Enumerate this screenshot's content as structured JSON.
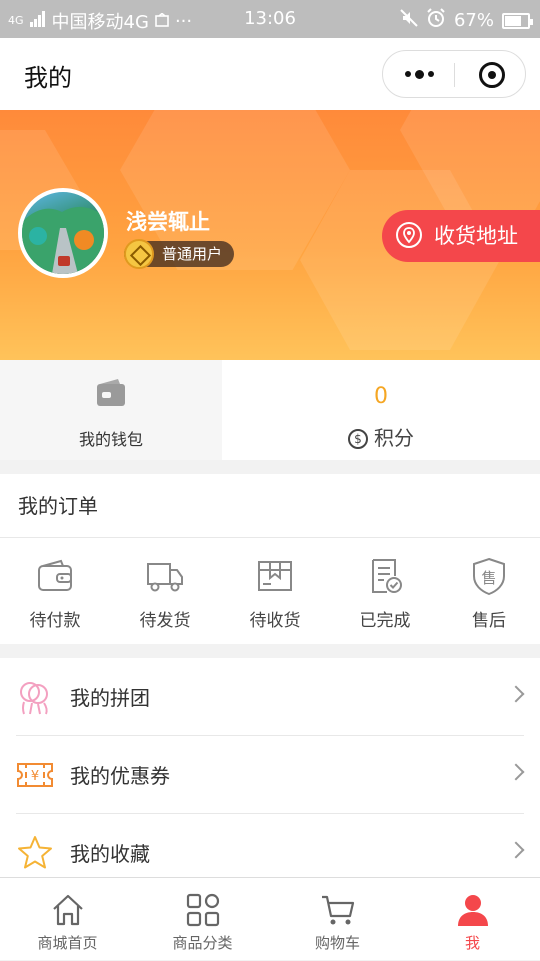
{
  "status_bar": {
    "carrier": "中国移动4G",
    "network_tag": "4G",
    "more": "···",
    "time": "13:06",
    "battery": "67%"
  },
  "nav": {
    "title": "我的",
    "more_icon": "more-dots-icon",
    "target_icon": "target-icon"
  },
  "profile": {
    "name": "浅尝辄止",
    "level": "普通用户",
    "address_button": "收货地址"
  },
  "assets": {
    "wallet_label": "我的钱包",
    "points_value": "0",
    "points_label": "积分",
    "points_symbol": "$"
  },
  "orders": {
    "title": "我的订单",
    "items": [
      {
        "label": "待付款",
        "icon": "wallet-icon"
      },
      {
        "label": "待发货",
        "icon": "truck-icon"
      },
      {
        "label": "待收货",
        "icon": "package-icon"
      },
      {
        "label": "已完成",
        "icon": "completed-document-icon"
      },
      {
        "label": "售后",
        "icon": "after-sale-shield-icon",
        "glyph": "售"
      }
    ]
  },
  "menu": [
    {
      "label": "我的拼团",
      "icon": "group-buy-icon"
    },
    {
      "label": "我的优惠券",
      "icon": "coupon-icon",
      "glyph": "¥"
    },
    {
      "label": "我的收藏",
      "icon": "star-icon"
    }
  ],
  "tabbar": {
    "active_color": "#f4474b",
    "items": [
      {
        "label": "商城首页",
        "icon": "home-icon"
      },
      {
        "label": "商品分类",
        "icon": "category-icon"
      },
      {
        "label": "购物车",
        "icon": "cart-icon"
      },
      {
        "label": "我",
        "icon": "user-icon"
      }
    ]
  },
  "colors": {
    "banner_start": "#ff8a3a",
    "banner_end": "#ffc35a",
    "accent": "#f4474b",
    "points": "#f5a623"
  }
}
